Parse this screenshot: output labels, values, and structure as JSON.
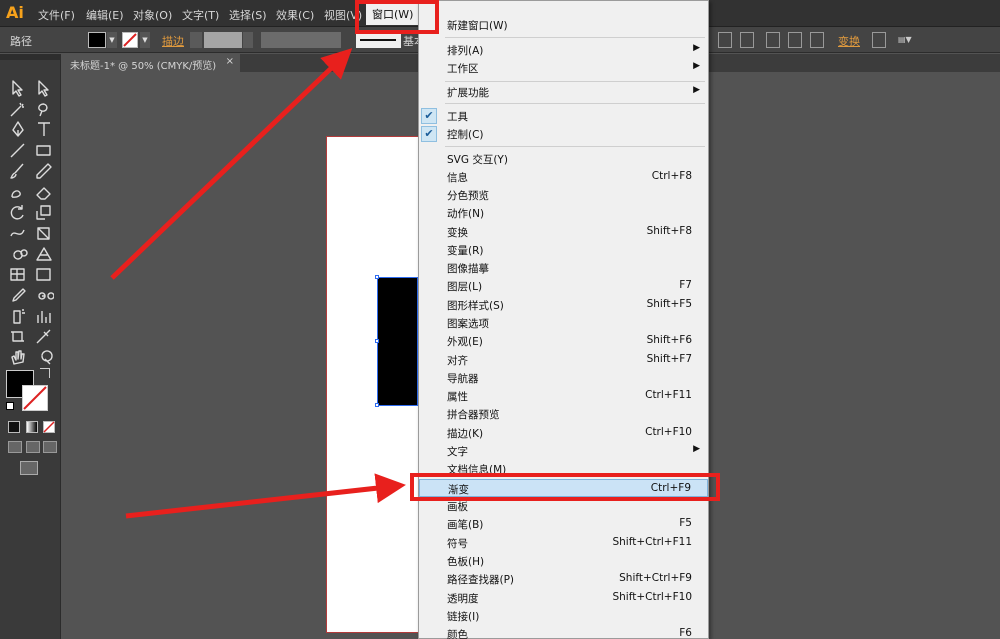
{
  "app": {
    "logo": "Ai"
  },
  "menubar": {
    "items": [
      "文件(F)",
      "编辑(E)",
      "对象(O)",
      "文字(T)",
      "选择(S)",
      "效果(C)",
      "视图(V)",
      "窗口(W)"
    ]
  },
  "controlbar": {
    "path_label": "路径",
    "stroke_label": "描边",
    "basic_label": "基本",
    "transform_label": "变换"
  },
  "document": {
    "tab_title": "未标题-1* @ 50% (CMYK/预览)",
    "close_glyph": "×"
  },
  "window_menu": {
    "items": [
      {
        "label": "新建窗口(W)",
        "shortcut": "",
        "submenu": false,
        "checked": false
      },
      {
        "label": "排列(A)",
        "shortcut": "",
        "submenu": true,
        "checked": false
      },
      {
        "label": "工作区",
        "shortcut": "",
        "submenu": true,
        "checked": false
      },
      {
        "label": "扩展功能",
        "shortcut": "",
        "submenu": true,
        "checked": false
      },
      {
        "label": "工具",
        "shortcut": "",
        "submenu": false,
        "checked": true
      },
      {
        "label": "控制(C)",
        "shortcut": "",
        "submenu": false,
        "checked": true
      },
      {
        "label": "SVG 交互(Y)",
        "shortcut": "",
        "submenu": false,
        "checked": false
      },
      {
        "label": "信息",
        "shortcut": "Ctrl+F8",
        "submenu": false,
        "checked": false
      },
      {
        "label": "分色预览",
        "shortcut": "",
        "submenu": false,
        "checked": false
      },
      {
        "label": "动作(N)",
        "shortcut": "",
        "submenu": false,
        "checked": false
      },
      {
        "label": "变换",
        "shortcut": "Shift+F8",
        "submenu": false,
        "checked": false
      },
      {
        "label": "变量(R)",
        "shortcut": "",
        "submenu": false,
        "checked": false
      },
      {
        "label": "图像描摹",
        "shortcut": "",
        "submenu": false,
        "checked": false
      },
      {
        "label": "图层(L)",
        "shortcut": "F7",
        "submenu": false,
        "checked": false
      },
      {
        "label": "图形样式(S)",
        "shortcut": "Shift+F5",
        "submenu": false,
        "checked": false
      },
      {
        "label": "图案选项",
        "shortcut": "",
        "submenu": false,
        "checked": false
      },
      {
        "label": "外观(E)",
        "shortcut": "Shift+F6",
        "submenu": false,
        "checked": false
      },
      {
        "label": "对齐",
        "shortcut": "Shift+F7",
        "submenu": false,
        "checked": false
      },
      {
        "label": "导航器",
        "shortcut": "",
        "submenu": false,
        "checked": false
      },
      {
        "label": "属性",
        "shortcut": "Ctrl+F11",
        "submenu": false,
        "checked": false
      },
      {
        "label": "拼合器预览",
        "shortcut": "",
        "submenu": false,
        "checked": false
      },
      {
        "label": "描边(K)",
        "shortcut": "Ctrl+F10",
        "submenu": false,
        "checked": false
      },
      {
        "label": "文字",
        "shortcut": "",
        "submenu": true,
        "checked": false
      },
      {
        "label": "文档信息(M)",
        "shortcut": "",
        "submenu": false,
        "checked": false
      },
      {
        "label": "渐变",
        "shortcut": "Ctrl+F9",
        "submenu": false,
        "checked": false,
        "highlighted": true
      },
      {
        "label": "画板",
        "shortcut": "",
        "submenu": false,
        "checked": false
      },
      {
        "label": "画笔(B)",
        "shortcut": "F5",
        "submenu": false,
        "checked": false
      },
      {
        "label": "符号",
        "shortcut": "Shift+Ctrl+F11",
        "submenu": false,
        "checked": false
      },
      {
        "label": "色板(H)",
        "shortcut": "",
        "submenu": false,
        "checked": false
      },
      {
        "label": "路径查找器(P)",
        "shortcut": "Shift+Ctrl+F9",
        "submenu": false,
        "checked": false
      },
      {
        "label": "透明度",
        "shortcut": "Shift+Ctrl+F10",
        "submenu": false,
        "checked": false
      },
      {
        "label": "链接(I)",
        "shortcut": "",
        "submenu": false,
        "checked": false
      },
      {
        "label": "颜色",
        "shortcut": "F6",
        "submenu": false,
        "checked": false
      }
    ]
  },
  "colors": {
    "annotation_red": "#e8201d",
    "highlight_blue": "#cbe3f6",
    "logo_orange": "#f7a21b"
  }
}
